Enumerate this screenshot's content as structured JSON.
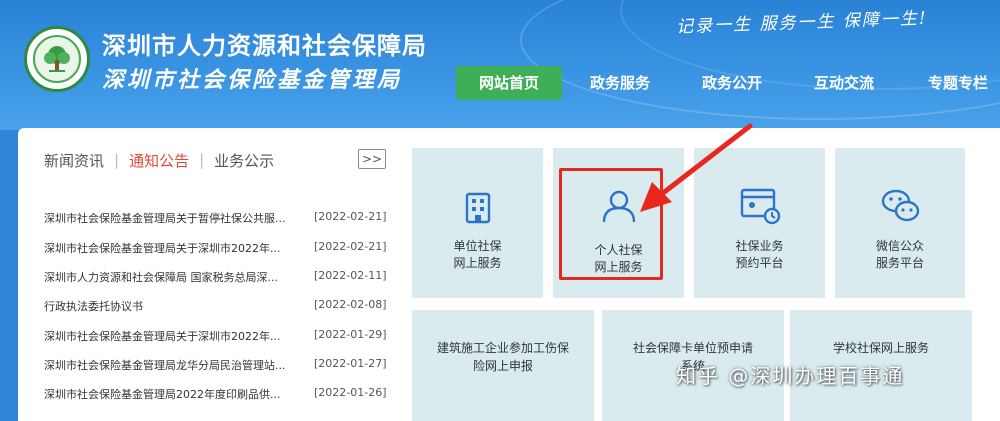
{
  "header": {
    "org_name_1": "深圳市人力资源和社会保障局",
    "org_name_2": "深圳市社会保险基金管理局",
    "slogan": "记录一生 服务一生 保障一生!",
    "logo_text": "深圳市人力资源和社会保障局"
  },
  "nav": {
    "items": [
      {
        "label": "网站首页",
        "active": true
      },
      {
        "label": "政务服务"
      },
      {
        "label": "政务公开"
      },
      {
        "label": "互动交流"
      },
      {
        "label": "专题专栏"
      }
    ]
  },
  "news": {
    "tabs": [
      {
        "label": "新闻资讯"
      },
      {
        "label": "通知公告",
        "active": true
      },
      {
        "label": "业务公示"
      }
    ],
    "more_label": ">>",
    "items": [
      {
        "title": "深圳市社会保险基金管理局关于暂停社保公共服...",
        "date": "[2022-02-21]"
      },
      {
        "title": "深圳市社会保险基金管理局关于深圳市2022年...",
        "date": "[2022-02-21]"
      },
      {
        "title": "深圳市人力资源和社会保障局 国家税务总局深...",
        "date": "[2022-02-11]"
      },
      {
        "title": "行政执法委托协议书",
        "date": "[2022-02-08]"
      },
      {
        "title": "深圳市社会保险基金管理局关于深圳市2022年...",
        "date": "[2022-01-29]"
      },
      {
        "title": "深圳市社会保险基金管理局龙华分局民治管理站...",
        "date": "[2022-01-27]"
      },
      {
        "title": "深圳市社会保险基金管理局2022年度印刷品供...",
        "date": "[2022-01-26]"
      }
    ]
  },
  "services": {
    "unit_online": {
      "line1": "单位社保",
      "line2": "网上服务",
      "icon": "building-icon"
    },
    "personal_online": {
      "line1": "个人社保",
      "line2": "网上服务",
      "icon": "person-icon"
    },
    "appointment": {
      "line1": "社保业务",
      "line2": "预约平台",
      "icon": "calendar-clock-icon"
    },
    "wechat": {
      "line1": "微信公众",
      "line2": "服务平台",
      "icon": "wechat-icon"
    },
    "construction": {
      "line1": "建筑施工企业参加工伤保",
      "line2": "险网上申报"
    },
    "card_apply": {
      "line1": "社会保障卡单位预申请",
      "line2": "系统"
    },
    "school": {
      "line1": "学校社保网上服务",
      "line2": ""
    }
  },
  "watermark": "知乎 @深圳办理百事通",
  "colors": {
    "header_blue": "#2f86d8",
    "nav_active_green": "#3fae58",
    "tile_bg": "#d9ebef",
    "icon_blue": "#2d74c8",
    "highlight_red": "#e8271f",
    "tab_active_red": "#e04a3a"
  }
}
